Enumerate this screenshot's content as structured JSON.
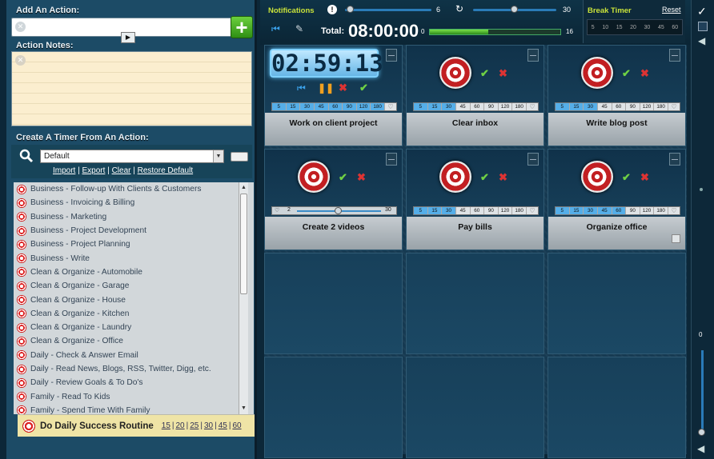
{
  "left": {
    "add_action_label": "Add An Action:",
    "action_input_value": "",
    "add_button": "+",
    "notes_label": "Action Notes:",
    "notes_value": "",
    "create_label": "Create A Timer From An Action:",
    "select_value": "Default",
    "links": [
      "Import",
      "Export",
      "Clear",
      "Restore Default"
    ],
    "items": [
      "Business - Follow-up With Clients & Customers",
      "Business - Invoicing & Billing",
      "Business - Marketing",
      "Business - Project Development",
      "Business - Project Planning",
      "Business - Write",
      "Clean & Organize - Automobile",
      "Clean & Organize - Garage",
      "Clean & Organize - House",
      "Clean & Organize - Kitchen",
      "Clean & Organize - Laundry",
      "Clean & Organize - Office",
      "Daily - Check & Answer Email",
      "Daily - Read News, Blogs, RSS, Twitter, Digg, etc.",
      "Daily - Review Goals & To Do's",
      "Family - Read To Kids",
      "Family - Spend Time With Family"
    ],
    "routine": {
      "do": "Do",
      "name": "Daily Success Routine",
      "minutes": [
        "15",
        "20",
        "25",
        "30",
        "45",
        "60"
      ]
    }
  },
  "top": {
    "notifications_label": "Notifications",
    "notify_count": "6",
    "repeat_value": "30",
    "total_label": "Total:",
    "total_time": "08:00:00",
    "progress_start": "0",
    "progress_end": "16",
    "break_label": "Break Timer",
    "reset_label": "Reset",
    "break_minutes": [
      "5",
      "10",
      "15",
      "20",
      "30",
      "45",
      "60"
    ]
  },
  "ruler_values": [
    "5",
    "15",
    "30",
    "45",
    "60",
    "90",
    "120",
    "180"
  ],
  "timers": [
    {
      "name": "Work on client project",
      "clock": "02:59:13",
      "active": true
    },
    {
      "name": "Clear inbox"
    },
    {
      "name": "Write blog post"
    },
    {
      "name": "Create 2 videos",
      "slider_min": "2",
      "slider_max": "30"
    },
    {
      "name": "Pay bills"
    },
    {
      "name": "Organize office"
    }
  ],
  "colors": {
    "accent": "#2a7bb8",
    "progress": "#5fc43a",
    "clock": "#8fd3ff"
  }
}
